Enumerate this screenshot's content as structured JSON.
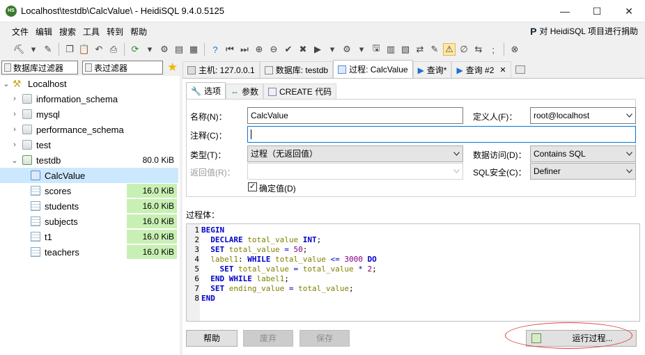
{
  "window": {
    "title": "Localhost\\testdb\\CalcValue\\ - HeidiSQL 9.4.0.5125",
    "app_icon_text": "HS",
    "minimize": "—",
    "maximize": "☐",
    "close": "✕"
  },
  "menu": {
    "items": [
      "文件",
      "编辑",
      "搜索",
      "工具",
      "转到",
      "帮助"
    ],
    "donate": "对 HeidiSQL 项目进行捐助",
    "donate_icon": "P"
  },
  "filters": {
    "db_filter": "数据库过滤器",
    "table_filter": "表过滤器"
  },
  "tree": {
    "items": [
      {
        "label": "Localhost",
        "size": ""
      },
      {
        "label": "information_schema",
        "size": ""
      },
      {
        "label": "mysql",
        "size": ""
      },
      {
        "label": "performance_schema",
        "size": ""
      },
      {
        "label": "test",
        "size": ""
      },
      {
        "label": "testdb",
        "size": "80.0 KiB"
      },
      {
        "label": "CalcValue",
        "size": ""
      },
      {
        "label": "scores",
        "size": "16.0 KiB"
      },
      {
        "label": "students",
        "size": "16.0 KiB"
      },
      {
        "label": "subjects",
        "size": "16.0 KiB"
      },
      {
        "label": "t1",
        "size": "16.0 KiB"
      },
      {
        "label": "teachers",
        "size": "16.0 KiB"
      }
    ]
  },
  "tabs": {
    "host": "主机: 127.0.0.1",
    "database": "数据库: testdb",
    "procedure": "过程: CalcValue",
    "query": "查询*",
    "query2": "查询 #2",
    "close": "✕"
  },
  "subtabs": {
    "options": "选项",
    "params": "参数",
    "create_code": "CREATE 代码"
  },
  "form": {
    "name_label": "名称(N)：",
    "name_value": "CalcValue",
    "definer_label": "定义人(F)：",
    "definer_value": "root@localhost",
    "comment_label": "注释(C)：",
    "comment_value": "",
    "type_label": "类型(T)：",
    "type_value": "过程（无返回值）",
    "data_access_label": "数据访问(D)：",
    "data_access_value": "Contains SQL",
    "returns_label": "返回值(R)：",
    "returns_value": "",
    "sql_security_label": "SQL安全(C)：",
    "sql_security_value": "Definer",
    "deterministic_label": "确定值(D)",
    "deterministic_checked": "✓"
  },
  "body": {
    "label": "过程体：",
    "lines": [
      {
        "n": "1",
        "indent": "",
        "tokens": [
          [
            "kw",
            "BEGIN"
          ]
        ]
      },
      {
        "n": "2",
        "indent": "  ",
        "tokens": [
          [
            "kw",
            "DECLARE"
          ],
          [
            "txt",
            " "
          ],
          [
            "id",
            "total_value"
          ],
          [
            "txt",
            " "
          ],
          [
            "ty",
            "INT"
          ],
          [
            "txt",
            ";"
          ]
        ]
      },
      {
        "n": "3",
        "indent": "  ",
        "tokens": [
          [
            "kw",
            "SET"
          ],
          [
            "txt",
            " "
          ],
          [
            "id",
            "total_value"
          ],
          [
            "txt",
            " "
          ],
          [
            "op",
            "="
          ],
          [
            "txt",
            " "
          ],
          [
            "num",
            "50"
          ],
          [
            "txt",
            ";"
          ]
        ]
      },
      {
        "n": "4",
        "indent": "  ",
        "tokens": [
          [
            "id",
            "label1"
          ],
          [
            "txt",
            ": "
          ],
          [
            "kw",
            "WHILE"
          ],
          [
            "txt",
            " "
          ],
          [
            "id",
            "total_value"
          ],
          [
            "txt",
            " "
          ],
          [
            "op",
            "<="
          ],
          [
            "txt",
            " "
          ],
          [
            "num",
            "3000"
          ],
          [
            "txt",
            " "
          ],
          [
            "kw",
            "DO"
          ]
        ]
      },
      {
        "n": "5",
        "indent": "    ",
        "tokens": [
          [
            "kw",
            "SET"
          ],
          [
            "txt",
            " "
          ],
          [
            "id",
            "total_value"
          ],
          [
            "txt",
            " "
          ],
          [
            "op",
            "="
          ],
          [
            "txt",
            " "
          ],
          [
            "id",
            "total_value"
          ],
          [
            "txt",
            " "
          ],
          [
            "op",
            "*"
          ],
          [
            "txt",
            " "
          ],
          [
            "num",
            "2"
          ],
          [
            "txt",
            ";"
          ]
        ]
      },
      {
        "n": "6",
        "indent": "  ",
        "tokens": [
          [
            "kw",
            "END"
          ],
          [
            "txt",
            " "
          ],
          [
            "kw",
            "WHILE"
          ],
          [
            "txt",
            " "
          ],
          [
            "id",
            "label1"
          ],
          [
            "txt",
            ";"
          ]
        ]
      },
      {
        "n": "7",
        "indent": "  ",
        "tokens": [
          [
            "kw",
            "SET"
          ],
          [
            "txt",
            " "
          ],
          [
            "id",
            "ending_value"
          ],
          [
            "txt",
            " "
          ],
          [
            "op",
            "="
          ],
          [
            "txt",
            " "
          ],
          [
            "id",
            "total_value"
          ],
          [
            "txt",
            ";"
          ]
        ]
      },
      {
        "n": "8",
        "indent": "",
        "tokens": [
          [
            "kw",
            "END"
          ]
        ]
      }
    ]
  },
  "buttons": {
    "help": "帮助",
    "discard": "废弃",
    "save": "保存",
    "run": "运行过程..."
  },
  "colors": {
    "size_highlight": "#c9f0b4",
    "selected_row": "#cce8ff",
    "annotation_oval": "#e23a3a"
  }
}
